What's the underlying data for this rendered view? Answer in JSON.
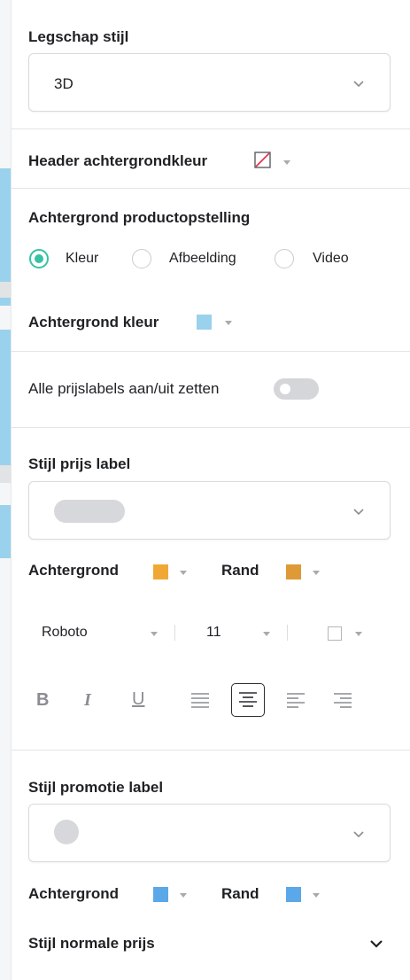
{
  "sections": {
    "landscape_style": {
      "label": "Legschap stijl",
      "value": "3D"
    },
    "header_background": {
      "label": "Header achtergrondkleur"
    },
    "product_background": {
      "label": "Achtergrond productopstelling",
      "options": [
        "Kleur",
        "Afbeelding",
        "Video"
      ],
      "selected": "Kleur"
    },
    "background_color": {
      "label": "Achtergrond kleur",
      "color": "#9ad1ec"
    },
    "price_labels_toggle": {
      "label": "Alle prijslabels aan/uit zetten",
      "on": false
    },
    "price_label_style": {
      "label": "Stijl prijs label",
      "background_label": "Achtergrond",
      "background_color": "#f0a835",
      "border_label": "Rand",
      "border_color": "#dd9a36",
      "font": "Roboto",
      "font_size": "11",
      "format_bold": "B",
      "format_italic": "I",
      "format_underline": "U"
    },
    "promo_label_style": {
      "label": "Stijl promotie label",
      "background_label": "Achtergrond",
      "background_color": "#5aa8e8",
      "border_label": "Rand",
      "border_color": "#5aa8e8"
    },
    "normal_price_style": {
      "label": "Stijl normale prijs"
    }
  },
  "colors": {
    "accent": "#38c2a5",
    "divider": "#e3e4e6"
  }
}
